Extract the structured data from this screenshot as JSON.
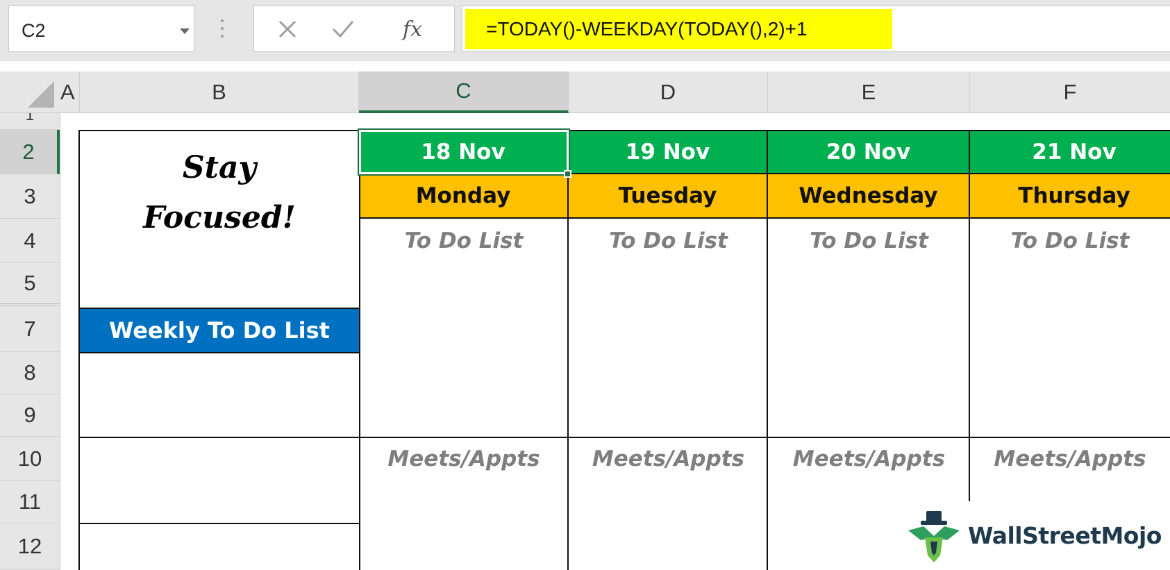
{
  "formula_bar": {
    "name_box": "C2",
    "cancel_icon": "close-icon",
    "enter_icon": "check-icon",
    "fx_label": "fx",
    "formula": "=TODAY()-WEEKDAY(TODAY(),2)+1",
    "formula_highlight_color": "#ffff00"
  },
  "column_headers": [
    "A",
    "B",
    "C",
    "D",
    "E",
    "F"
  ],
  "selected_column": "C",
  "row_headers": [
    "1",
    "2",
    "3",
    "4",
    "5",
    "7",
    "8",
    "9",
    "10",
    "11",
    "12"
  ],
  "selected_row": "2",
  "title_block": {
    "line1": "Stay",
    "line2": "Focused!"
  },
  "weekly_label": "Weekly To Do List",
  "days": [
    {
      "date": "18 Nov",
      "weekday": "Monday",
      "todo": "To Do List",
      "meets": "Meets/Appts"
    },
    {
      "date": "19 Nov",
      "weekday": "Tuesday",
      "todo": "To Do List",
      "meets": "Meets/Appts"
    },
    {
      "date": "20 Nov",
      "weekday": "Wednesday",
      "todo": "To Do List",
      "meets": "Meets/Appts"
    },
    {
      "date": "21 Nov",
      "weekday": "Thursday",
      "todo": "To Do List",
      "meets": "Meets/Appts"
    }
  ],
  "colors": {
    "date_header": "#00b050",
    "weekday_header": "#ffc000",
    "weekly_label_bg": "#0070c0",
    "selection_green": "#217346",
    "label_gray": "#7f7f7f"
  },
  "watermark": {
    "brand": "WallStreetMojo",
    "logo_icon": "wallstreetmojo-logo-icon"
  }
}
